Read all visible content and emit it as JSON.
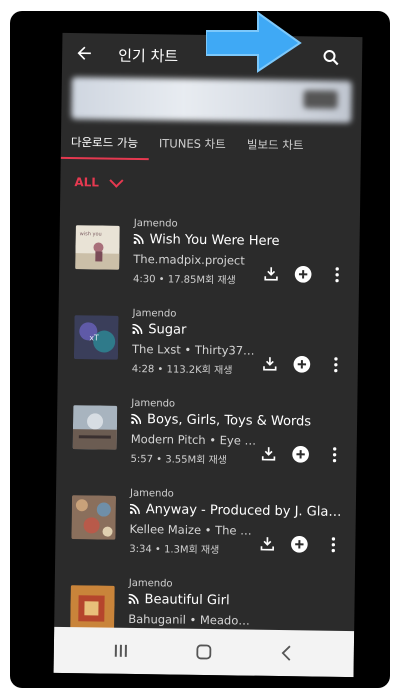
{
  "appbar": {
    "title": "인기 차트",
    "back_icon": "arrow-left-icon",
    "search_icon": "search-icon"
  },
  "tabs": [
    {
      "label": "다운로드 가능",
      "active": true
    },
    {
      "label": "ITUNES 차트",
      "active": false
    },
    {
      "label": "빌보드 차트",
      "active": false
    }
  ],
  "filter": {
    "label": "ALL",
    "icon": "chevron-down-icon"
  },
  "items": [
    {
      "source": "Jamendo",
      "title": "Wish You Were Here",
      "artist": "The.madpix.project",
      "meta": "4:30 • 17.85M회 재생"
    },
    {
      "source": "Jamendo",
      "title": "Sugar",
      "artist": "The Lxst • Thirty37S…",
      "meta": "4:28 • 113.2K회 재생"
    },
    {
      "source": "Jamendo",
      "title": "Boys, Girls, Toys & Words",
      "artist": "Modern Pitch • Eye O…",
      "meta": "5:57 • 3.55M회 재생"
    },
    {
      "source": "Jamendo",
      "title": "Anyway - Produced by J. Gla…",
      "artist": "Kellee Maize • The 5t…",
      "meta": "3:34 • 1.3M회 재생"
    },
    {
      "source": "Jamendo",
      "title": "Beautiful Girl",
      "artist": "Bahuganil • Meadowi…",
      "meta": ""
    }
  ],
  "colors": {
    "accent": "#e53950",
    "background": "#2b2b2b",
    "arrow": "#3fa9f5"
  }
}
